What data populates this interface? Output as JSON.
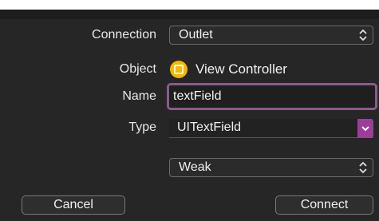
{
  "form": {
    "connection": {
      "label": "Connection",
      "value": "Outlet"
    },
    "object": {
      "label": "Object",
      "value": "View Controller",
      "icon": "view-controller-icon"
    },
    "name": {
      "label": "Name",
      "value": "textField"
    },
    "type": {
      "label": "Type",
      "value": "UITextField"
    },
    "storage": {
      "value": "Weak"
    }
  },
  "buttons": {
    "cancel": "Cancel",
    "connect": "Connect"
  },
  "colors": {
    "panel_bg": "#262626",
    "focus_ring": "#8b5a8c",
    "dropdown_accent": "#9b3e9a",
    "object_icon": "#f5b800"
  }
}
